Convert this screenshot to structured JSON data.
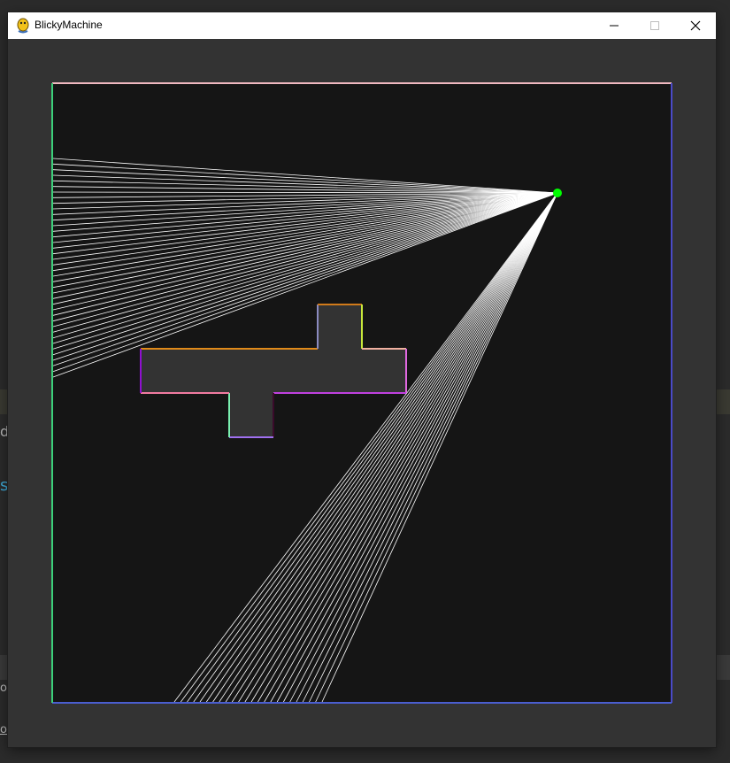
{
  "window": {
    "title": "BlickyMachine",
    "controls": {
      "minimize_icon": "minimize-icon",
      "maximize_icon": "maximize-icon",
      "close_icon": "close-icon"
    }
  },
  "background_fragments": [
    "d",
    "s",
    "or",
    "or"
  ],
  "colors": {
    "window_bg": "#333333",
    "arena_bg": "#151515",
    "ray": "#ffffff",
    "light_source": "#00ff00",
    "obstacle_fill": "#333333",
    "border_top": "#f0b8c0",
    "border_right": "#4a4ac8",
    "border_bottom": "#4a5ed0",
    "border_left": "#3cd07a"
  }
}
